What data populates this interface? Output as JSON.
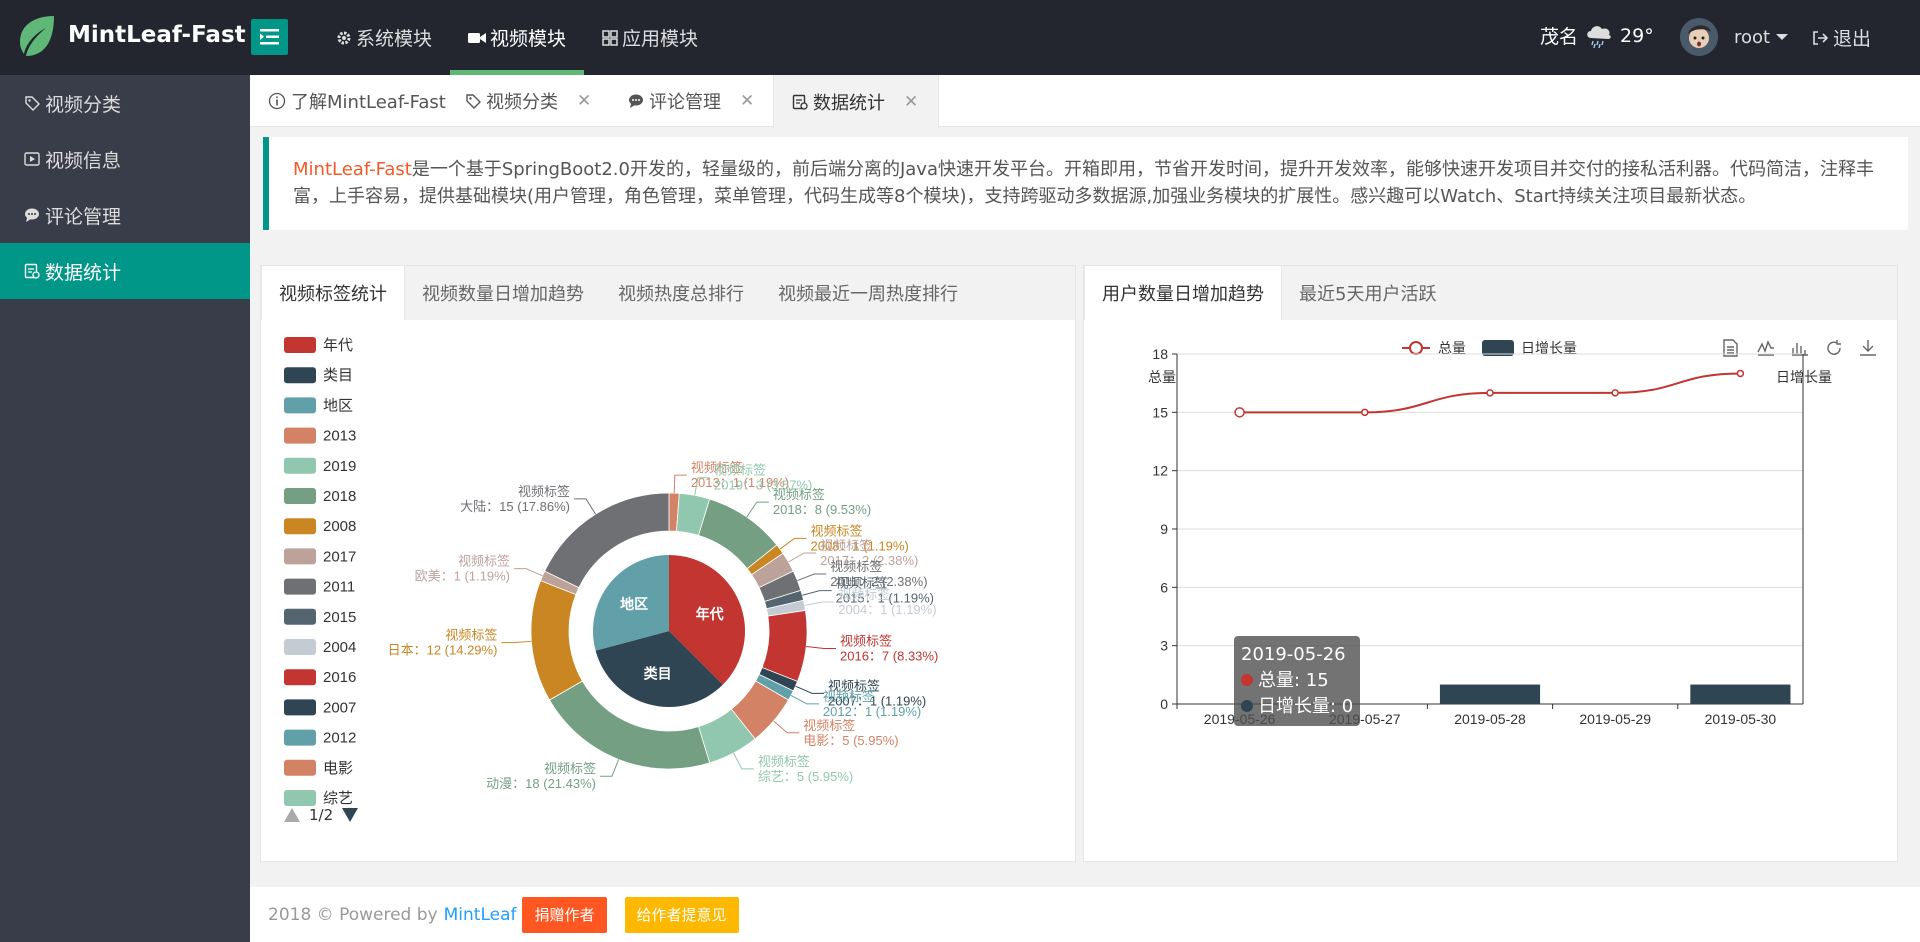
{
  "app": {
    "title": "MintLeaf-Fast"
  },
  "topnav": [
    {
      "label": "系统模块",
      "icon": "gear-icon"
    },
    {
      "label": "视频模块",
      "icon": "video-icon"
    },
    {
      "label": "应用模块",
      "icon": "apps-icon"
    }
  ],
  "weather": {
    "city": "茂名",
    "temp": "29°",
    "icon": "rain-cloud-icon"
  },
  "user": {
    "name": "root",
    "logout": "退出"
  },
  "sidebar": [
    {
      "label": "视频分类",
      "icon": "tag-icon"
    },
    {
      "label": "视频信息",
      "icon": "play-icon"
    },
    {
      "label": "评论管理",
      "icon": "comment-icon"
    },
    {
      "label": "数据统计",
      "icon": "stats-icon",
      "active": true
    }
  ],
  "tabs": [
    {
      "label": "了解MintLeaf-Fast",
      "icon": "info-icon"
    },
    {
      "label": "视频分类",
      "icon": "tag-icon"
    },
    {
      "label": "评论管理",
      "icon": "comment-icon"
    },
    {
      "label": "数据统计",
      "icon": "stats-icon",
      "active": true
    }
  ],
  "notice": {
    "brand": "MintLeaf-Fast",
    "text": "是一个基于SpringBoot2.0开发的，轻量级的，前后端分离的Java快速开发平台。开箱即用，节省开发时间，提升开发效率，能够快速开发项目并交付的接私活利器。代码简洁，注释丰富，上手容易，提供基础模块(用户管理，角色管理，菜单管理，代码生成等8个模块)，支持跨驱动多数据源,加强业务模块的扩展性。感兴趣可以Watch、Start持续关注项目最新状态。"
  },
  "left_panel": {
    "tabs": [
      "视频标签统计",
      "视频数量日增加趋势",
      "视频热度总排行",
      "视频最近一周热度排行"
    ],
    "legend_page": "1/2"
  },
  "right_panel": {
    "tabs": [
      "用户数量日增加趋势",
      "最近5天用户活跃"
    ]
  },
  "tooltip": {
    "date": "2019-05-26",
    "line1": "总量: 15",
    "line2": "日增长量: 0"
  },
  "footer": {
    "text": "2018 © Powered by",
    "link": "MintLeaf",
    "btn1": "捐赠作者",
    "btn2": "给作者提意见"
  },
  "chart_data": [
    {
      "type": "pie",
      "title": "",
      "label_prefix": "视频标签",
      "inner": [
        {
          "name": "年代",
          "color": "#c23531",
          "pct": 37.5
        },
        {
          "name": "类目",
          "color": "#2f4554",
          "pct": 33.33
        },
        {
          "name": "地区",
          "color": "#61a0a8",
          "pct": 29.17
        }
      ],
      "outer": [
        {
          "name": "2013",
          "value": 1,
          "pct": "1.19%",
          "color": "#d48265"
        },
        {
          "name": "2019",
          "value": 3,
          "pct": "3.57%",
          "color": "#91c7ae"
        },
        {
          "name": "2018",
          "value": 8,
          "pct": "9.53%",
          "color": "#749f83"
        },
        {
          "name": "2008",
          "value": 1,
          "pct": "1.19%",
          "color": "#ca8622"
        },
        {
          "name": "2017",
          "value": 2,
          "pct": "2.38%",
          "color": "#bda29a"
        },
        {
          "name": "2011",
          "value": 2,
          "pct": "2.38%",
          "color": "#6e7074"
        },
        {
          "name": "2015",
          "value": 1,
          "pct": "1.19%",
          "color": "#546570"
        },
        {
          "name": "2004",
          "value": 1,
          "pct": "1.19%",
          "color": "#c4ccd3"
        },
        {
          "name": "2016",
          "value": 7,
          "pct": "8.33%",
          "color": "#c23531"
        },
        {
          "name": "2007",
          "value": 1,
          "pct": "1.19%",
          "color": "#2f4554"
        },
        {
          "name": "2012",
          "value": 1,
          "pct": "1.19%",
          "color": "#61a0a8"
        },
        {
          "name": "电影",
          "value": 5,
          "pct": "5.95%",
          "color": "#d48265"
        },
        {
          "name": "综艺",
          "value": 5,
          "pct": "5.95%",
          "color": "#91c7ae"
        },
        {
          "name": "动漫",
          "value": 18,
          "pct": "21.43%",
          "color": "#749f83"
        },
        {
          "name": "日本",
          "value": 12,
          "pct": "14.29%",
          "color": "#ca8622"
        },
        {
          "name": "欧美",
          "value": 1,
          "pct": "1.19%",
          "color": "#bda29a"
        },
        {
          "name": "大陆",
          "value": 15,
          "pct": "17.86%",
          "color": "#6e7074"
        }
      ],
      "legend": [
        {
          "name": "年代",
          "color": "#c23531"
        },
        {
          "name": "类目",
          "color": "#2f4554"
        },
        {
          "name": "地区",
          "color": "#61a0a8"
        },
        {
          "name": "2013",
          "color": "#d48265"
        },
        {
          "name": "2019",
          "color": "#91c7ae"
        },
        {
          "name": "2018",
          "color": "#749f83"
        },
        {
          "name": "2008",
          "color": "#ca8622"
        },
        {
          "name": "2017",
          "color": "#bda29a"
        },
        {
          "name": "2011",
          "color": "#6e7074"
        },
        {
          "name": "2015",
          "color": "#546570"
        },
        {
          "name": "2004",
          "color": "#c4ccd3"
        },
        {
          "name": "2016",
          "color": "#c23531"
        },
        {
          "name": "2007",
          "color": "#2f4554"
        },
        {
          "name": "2012",
          "color": "#61a0a8"
        },
        {
          "name": "电影",
          "color": "#d48265"
        },
        {
          "name": "综艺",
          "color": "#91c7ae"
        }
      ]
    },
    {
      "type": "line",
      "categories": [
        "2019-05-26",
        "2019-05-27",
        "2019-05-28",
        "2019-05-29",
        "2019-05-30"
      ],
      "series": [
        {
          "name": "总量",
          "kind": "line",
          "color": "#c23531",
          "values": [
            15,
            15,
            16,
            16,
            17
          ]
        },
        {
          "name": "日增长量",
          "kind": "bar",
          "color": "#2f4554",
          "values": [
            0,
            0,
            1,
            0,
            1
          ]
        }
      ],
      "ylabel_left": "总量",
      "ylabel_right": "日增长量",
      "ylim": [
        0,
        18
      ],
      "yticks": [
        "0",
        "3",
        "6",
        "9",
        "12",
        "15",
        "18"
      ],
      "grid": true,
      "legend_position": "top-center"
    }
  ]
}
